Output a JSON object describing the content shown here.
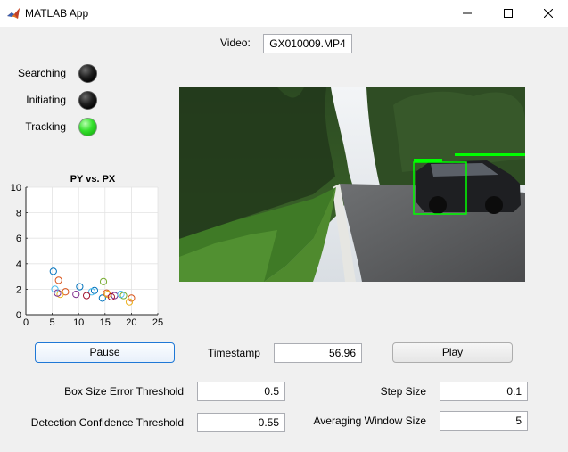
{
  "window": {
    "title": "MATLAB App",
    "controls": [
      "minimize-icon",
      "maximize-icon",
      "close-icon"
    ]
  },
  "video": {
    "label": "Video:",
    "filename": "GX010009.MP4"
  },
  "status": [
    {
      "label": "Searching",
      "state": "off"
    },
    {
      "label": "Initiating",
      "state": "off"
    },
    {
      "label": "Tracking",
      "state": "on"
    }
  ],
  "colors": {
    "lamp_on": "#34e02c",
    "lamp_off": "#000000",
    "bbox": "#00ff00",
    "focus_border": "#1f78d6"
  },
  "buttons": {
    "pause": "Pause",
    "play": "Play"
  },
  "timestamp": {
    "label": "Timestamp",
    "value": "56.96"
  },
  "params": {
    "box_size_error_threshold": {
      "label": "Box Size Error Threshold",
      "value": "0.5"
    },
    "detection_confidence_threshold": {
      "label": "Detection Confidence Threshold",
      "value": "0.55"
    },
    "step_size": {
      "label": "Step Size",
      "value": "0.1"
    },
    "averaging_window_size": {
      "label": "Averaging Window Size",
      "value": "5"
    }
  },
  "chart_data": {
    "type": "scatter",
    "title": "PY vs. PX",
    "xlabel": "",
    "ylabel": "",
    "xlim": [
      0,
      25
    ],
    "ylim": [
      0,
      10
    ],
    "xticks": [
      0,
      5,
      10,
      15,
      20,
      25
    ],
    "yticks": [
      0,
      2,
      4,
      6,
      8,
      10
    ],
    "grid": true,
    "marker": "open-circle",
    "series": [
      {
        "color": "#0072bd",
        "x": [
          5.2,
          10.2,
          13,
          14.5
        ],
        "y": [
          3.4,
          2.2,
          1.9,
          1.3
        ]
      },
      {
        "color": "#d95319",
        "x": [
          6.2,
          7.5,
          15.3,
          20
        ],
        "y": [
          2.7,
          1.8,
          1.7,
          1.3
        ]
      },
      {
        "color": "#edb120",
        "x": [
          6.5,
          15.5,
          19.6
        ],
        "y": [
          1.6,
          1.6,
          1.0
        ]
      },
      {
        "color": "#7e2f8e",
        "x": [
          6,
          9.5,
          16.8
        ],
        "y": [
          1.7,
          1.6,
          1.5
        ]
      },
      {
        "color": "#77ac30",
        "x": [
          14.7,
          18.5
        ],
        "y": [
          2.6,
          1.5
        ]
      },
      {
        "color": "#4dbeee",
        "x": [
          5.5,
          12.5,
          18
        ],
        "y": [
          2.0,
          1.8,
          1.6
        ]
      },
      {
        "color": "#a2142f",
        "x": [
          11.5,
          16.2
        ],
        "y": [
          1.5,
          1.4
        ]
      }
    ]
  }
}
